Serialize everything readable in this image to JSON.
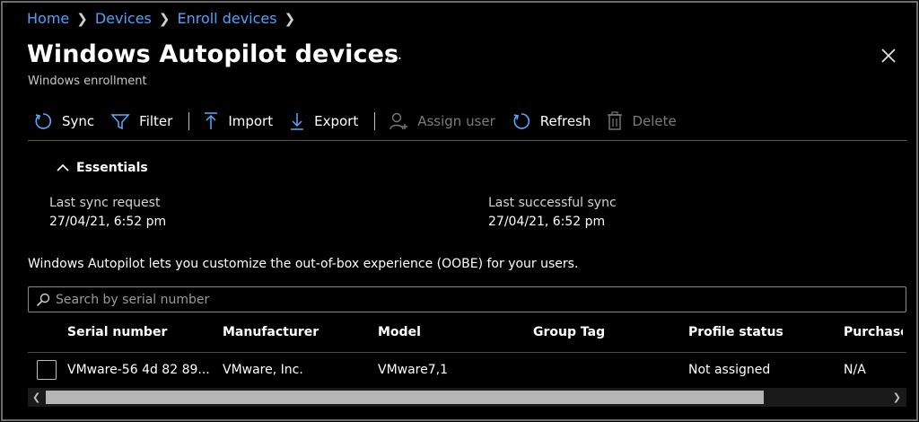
{
  "breadcrumb": {
    "items": [
      "Home",
      "Devices",
      "Enroll devices"
    ]
  },
  "header": {
    "title": "Windows Autopilot devices",
    "more": "···",
    "subtitle": "Windows enrollment"
  },
  "toolbar": {
    "sync": "Sync",
    "filter": "Filter",
    "import": "Import",
    "export": "Export",
    "assign_user": "Assign user",
    "refresh": "Refresh",
    "delete": "Delete"
  },
  "essentials": {
    "label": "Essentials",
    "last_sync_request_label": "Last sync request",
    "last_sync_request_value": "27/04/21, 6:52 pm",
    "last_successful_sync_label": "Last successful sync",
    "last_successful_sync_value": "27/04/21, 6:52 pm"
  },
  "info_text": "Windows Autopilot lets you customize the out-of-box experience (OOBE) for your users.",
  "search": {
    "placeholder": "Search by serial number"
  },
  "table": {
    "columns": [
      "Serial number",
      "Manufacturer",
      "Model",
      "Group Tag",
      "Profile status",
      "Purchase"
    ],
    "rows": [
      [
        "VMware-56 4d 82 89...",
        "VMware, Inc.",
        "VMware7,1",
        "",
        "Not assigned",
        "N/A"
      ]
    ]
  },
  "colors": {
    "link": "#4ea3ff",
    "accent_icon": "#5aa9ff",
    "disabled": "#7a7a7a"
  }
}
